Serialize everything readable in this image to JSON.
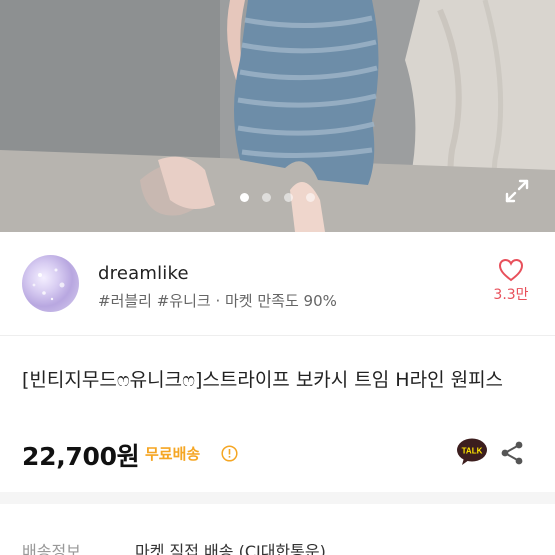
{
  "product_image": {
    "icon": "product-photo",
    "slide_count": 4,
    "active_slide": 1
  },
  "seller": {
    "name": "dreamlike",
    "tags": "#러블리 #유니크 · 마켓 만족도 90%",
    "like_count": "3.3만"
  },
  "product": {
    "title": "[빈티지무드ෆ유니크ෆ]스트라이프 보카시 트임 H라인 원피스",
    "price": "22,700원",
    "shipping_badge": "무료배송"
  },
  "shipping": {
    "label": "배송정보",
    "value": "마켓 직접 배송 (CJ대한통운)"
  },
  "colors": {
    "accent": "#e8505b",
    "badge": "#f5a623",
    "talk": "#3c1e1e",
    "talk_bg": "#fee500"
  }
}
